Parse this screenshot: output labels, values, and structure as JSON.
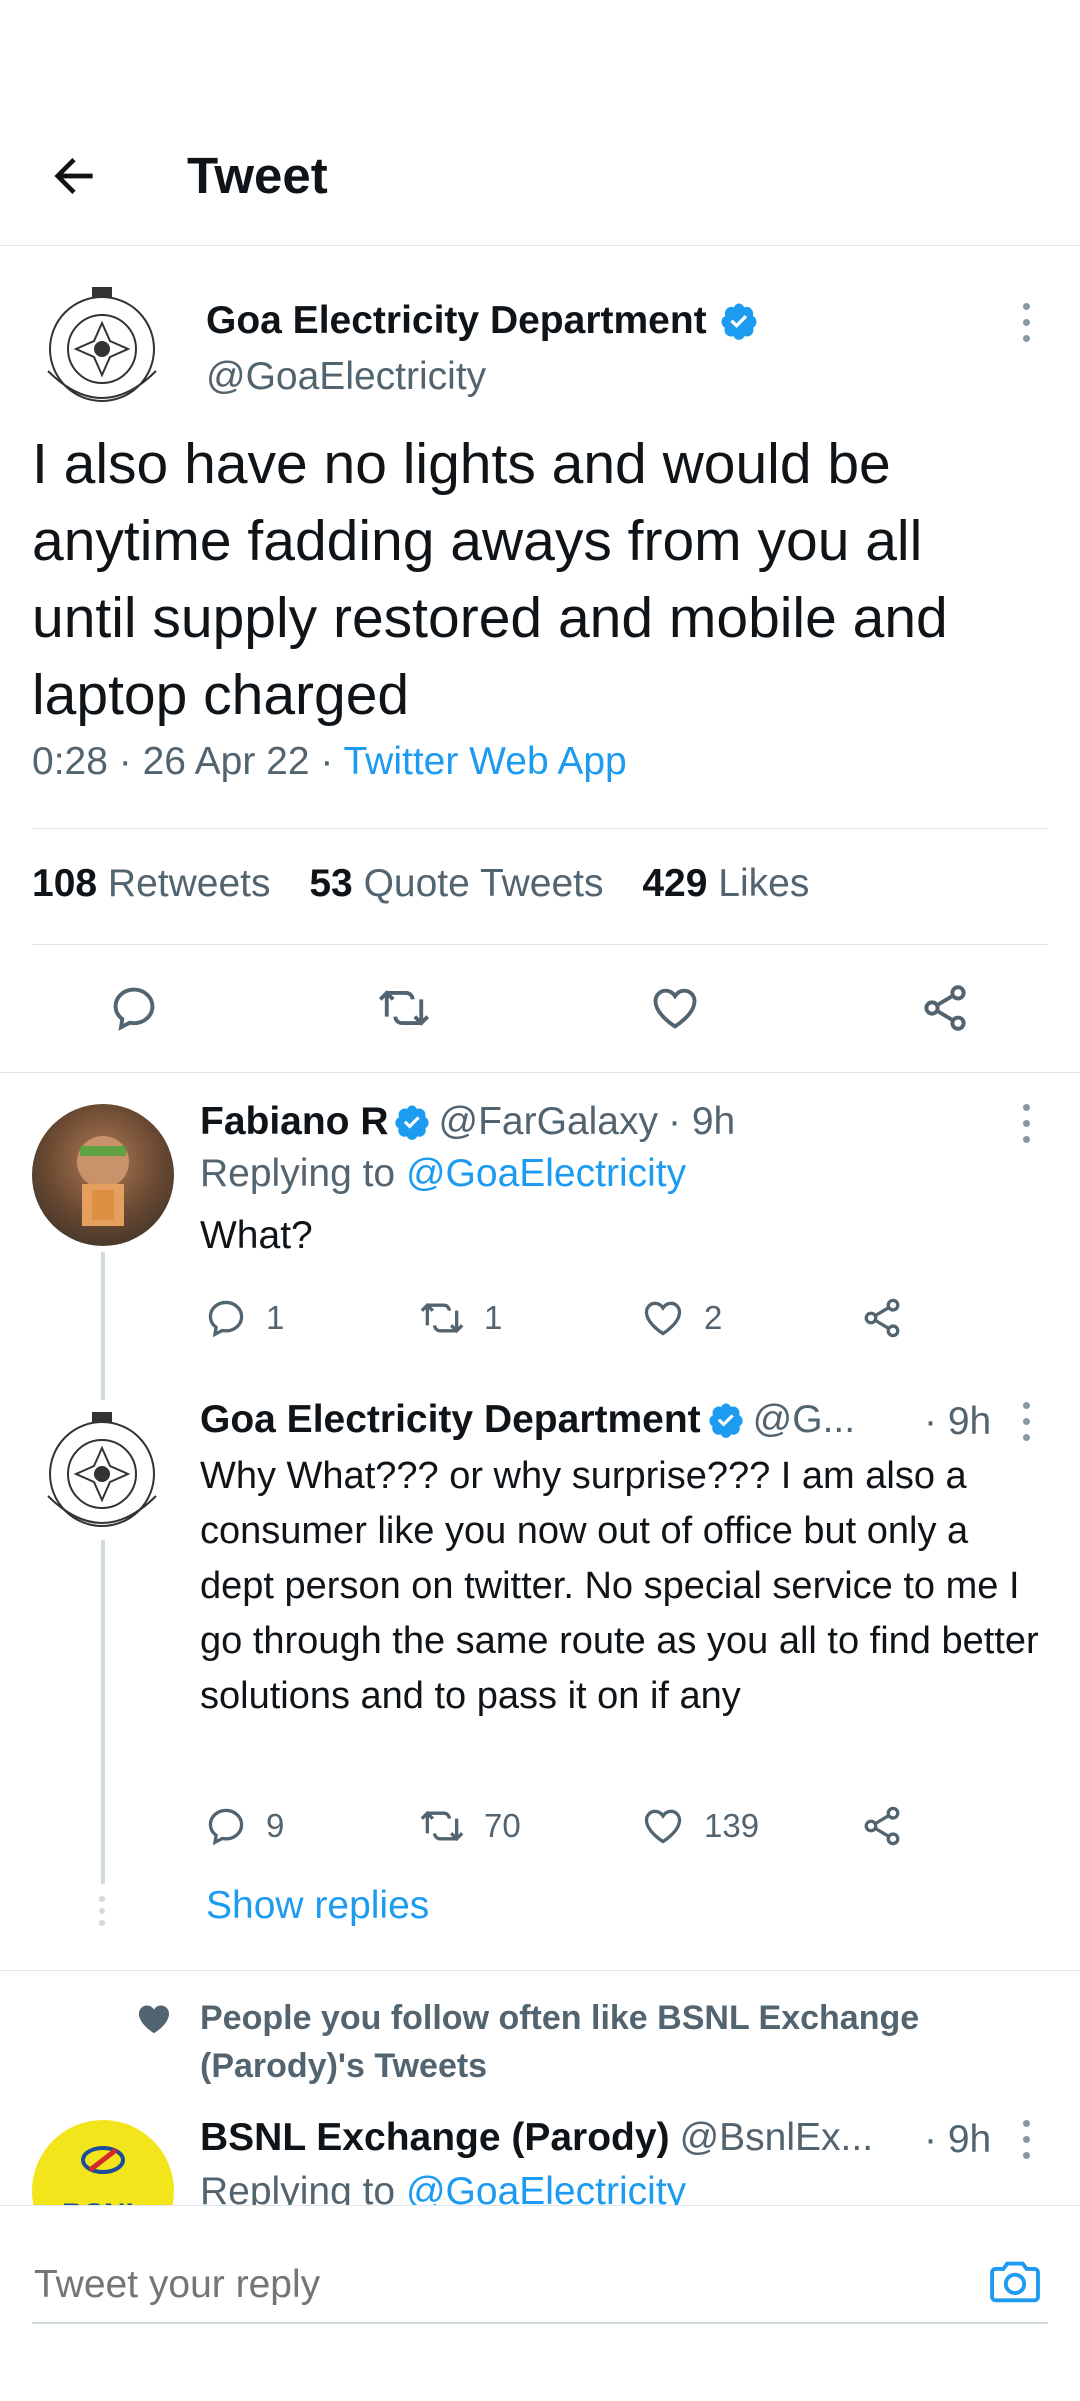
{
  "header": {
    "title": "Tweet"
  },
  "main_tweet": {
    "author_name": "Goa Electricity Department",
    "handle": "@GoaElectricity",
    "text": "I also have no lights and would be anytime fadding aways from you all until supply restored and mobile and laptop charged",
    "time": "0:28 · 26 Apr 22 · ",
    "source": "Twitter Web App",
    "stats": {
      "retweets_count": "108",
      "retweets_label": "Retweets",
      "quotes_count": "53",
      "quotes_label": "Quote Tweets",
      "likes_count": "429",
      "likes_label": "Likes"
    }
  },
  "replies": [
    {
      "name": "Fabiano R",
      "handle": "@FarGalaxy",
      "time": "· 9h",
      "replying_prefix": "Replying to ",
      "replying_to": "@GoaElectricity",
      "text": "What?",
      "reply_count": "1",
      "retweet_count": "1",
      "like_count": "2"
    },
    {
      "name": "Goa Electricity Department",
      "handle": "@G...",
      "time": "· 9h",
      "text": "Why What??? or why surprise??? I am also a consumer like you now out of office but only a dept person on twitter. No special service to me I go through the same route as you all to find better solutions and to pass it on if any",
      "reply_count": "9",
      "retweet_count": "70",
      "like_count": "139"
    }
  ],
  "show_replies": "Show replies",
  "suggestion": {
    "text": "People you follow often like BSNL Exchange (Parody)'s Tweets",
    "name": "BSNL Exchange (Parody)",
    "handle": "@BsnlEx...",
    "time": "· 9h",
    "replying_prefix": "Replying to ",
    "replying_to": "@GoaElectricity",
    "avatar_text": "BSNL"
  },
  "compose": {
    "placeholder": "Tweet your reply"
  },
  "colors": {
    "accent": "#1d9bf0",
    "text": "#0f1419",
    "muted": "#536471"
  }
}
